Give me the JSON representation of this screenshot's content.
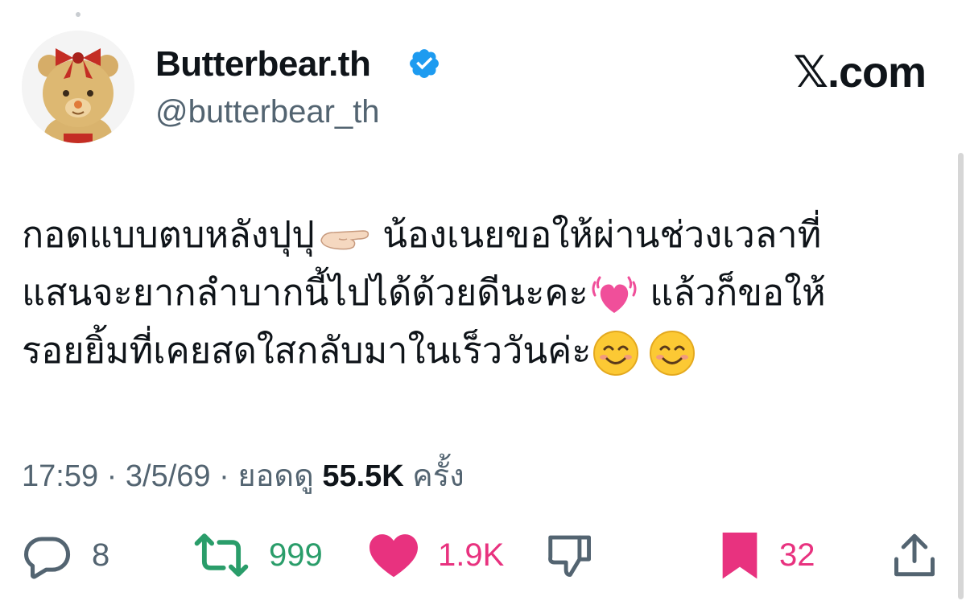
{
  "author": {
    "display_name": "Butterbear.th",
    "handle": "@butterbear_th",
    "verified": true
  },
  "brand": "𝕏.com",
  "tweet": {
    "lines": [
      {
        "text_a": "กอดแบบตบหลังปุปุ",
        "emoji_1": "hand-pointing-icon",
        "text_b": " น้องเนยขอให้ผ่านช่วงเวลาที่"
      },
      {
        "text_a": "แสนจะยากลำบากนี้ไปได้ด้วยดีนะคะ",
        "emoji_1": "beating-heart-icon",
        "text_b": " แล้วก็ขอให้"
      },
      {
        "text_a": "รอยยิ้มที่เคยสดใสกลับมาในเร็ววันค่ะ",
        "emoji_1": "smiling-face-icon",
        "emoji_2": "smiling-face-icon"
      }
    ]
  },
  "meta": {
    "time": "17:59",
    "sep1": " · ",
    "date": "3/5/69",
    "sep2": " · ",
    "views_label": "ยอดดู ",
    "views_count": "55.5K",
    "views_unit": " ครั้ง"
  },
  "actions": {
    "reply": {
      "icon": "reply-icon",
      "count": "8"
    },
    "retweet": {
      "icon": "retweet-icon",
      "count": "999"
    },
    "like": {
      "icon": "heart-icon",
      "count": "1.9K"
    },
    "dislike": {
      "icon": "thumbs-down-icon"
    },
    "bookmark": {
      "icon": "bookmark-icon",
      "count": "32"
    },
    "share": {
      "icon": "share-icon"
    }
  },
  "colors": {
    "text": "#0f1419",
    "secondary": "#536471",
    "retweet_green": "#2a9d6a",
    "like_pink": "#e8327f",
    "verified_blue": "#1d9bf0"
  }
}
